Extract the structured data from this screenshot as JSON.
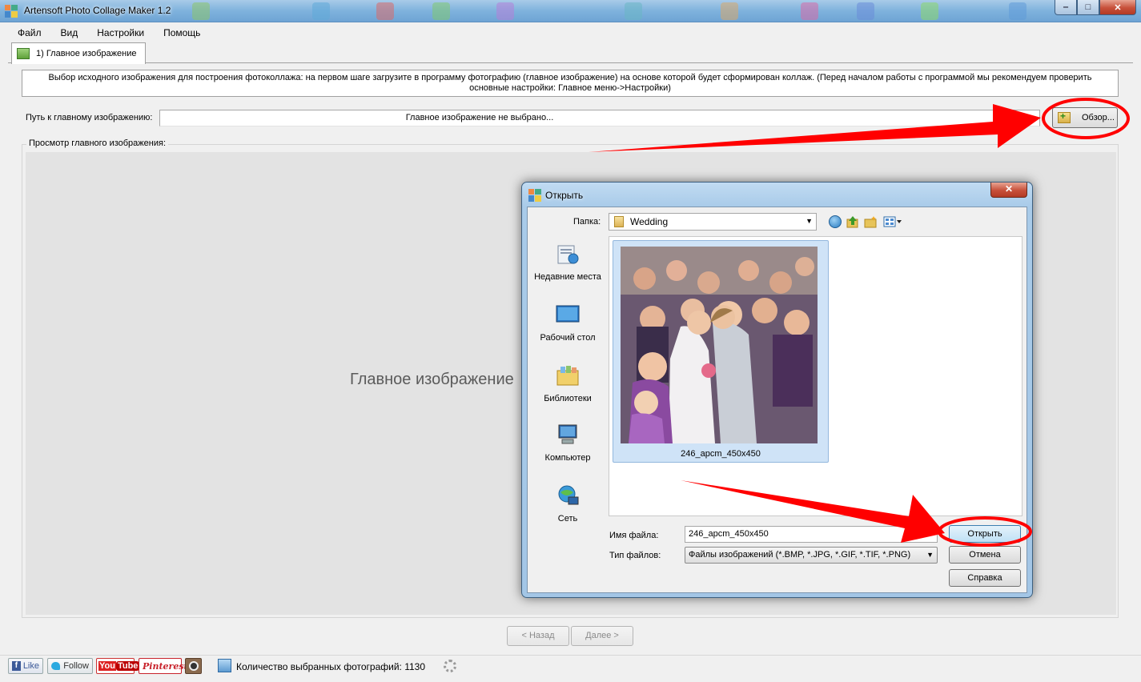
{
  "window": {
    "title": "Artensoft Photo Collage Maker 1.2",
    "controls": {
      "minimize": "‒",
      "maximize": "□",
      "close": "✕"
    }
  },
  "menu": [
    "Файл",
    "Вид",
    "Настройки",
    "Помощь"
  ],
  "tab": {
    "label": "1) Главное изображение"
  },
  "info": "Выбор исходного изображения для построения фотоколлажа: на первом шаге загрузите в программу фотографию (главное изображение) на основе которой будет сформирован коллаж. (Перед началом работы с программой мы рекомендуем проверить основные настройки: Главное меню->Настройки)",
  "path": {
    "label": "Путь к главному изображению:",
    "value": "Главное изображение не выбрано...",
    "browse_button": "Обзор..."
  },
  "preview": {
    "group_label": "Просмотр главного изображения:",
    "placeholder": "Главное изображение не выбрано"
  },
  "nav": {
    "back": "< Назад",
    "next": "Далее >"
  },
  "status": {
    "facebook": "Like",
    "twitter": "Follow",
    "youtube_you": "You",
    "youtube_tube": "Tube",
    "pinterest": "Pinterest",
    "count_text": "Количество выбранных фотографий: 1130"
  },
  "dialog": {
    "title": "Открыть",
    "close": "✕",
    "folder_label": "Папка:",
    "folder_value": "Wedding",
    "places": [
      "Недавние места",
      "Рабочий стол",
      "Библиотеки",
      "Компьютер",
      "Сеть"
    ],
    "file_item": "246_арсm_450x450",
    "file_name_label": "Имя файла:",
    "file_name_value": "246_арсm_450x450",
    "file_type_label": "Тип файлов:",
    "file_type_value": "Файлы изображений (*.BMP, *.JPG, *.GIF, *.TIF, *.PNG)",
    "buttons": {
      "open": "Открыть",
      "cancel": "Отмена",
      "help": "Справка"
    }
  },
  "colors": {
    "titlebar": "#7fb2dd",
    "window_bg": "#f0f0f0",
    "preview_bg": "#e3e3e3",
    "annotation_red": "#ff0000",
    "selection": "#cfe3f7"
  }
}
